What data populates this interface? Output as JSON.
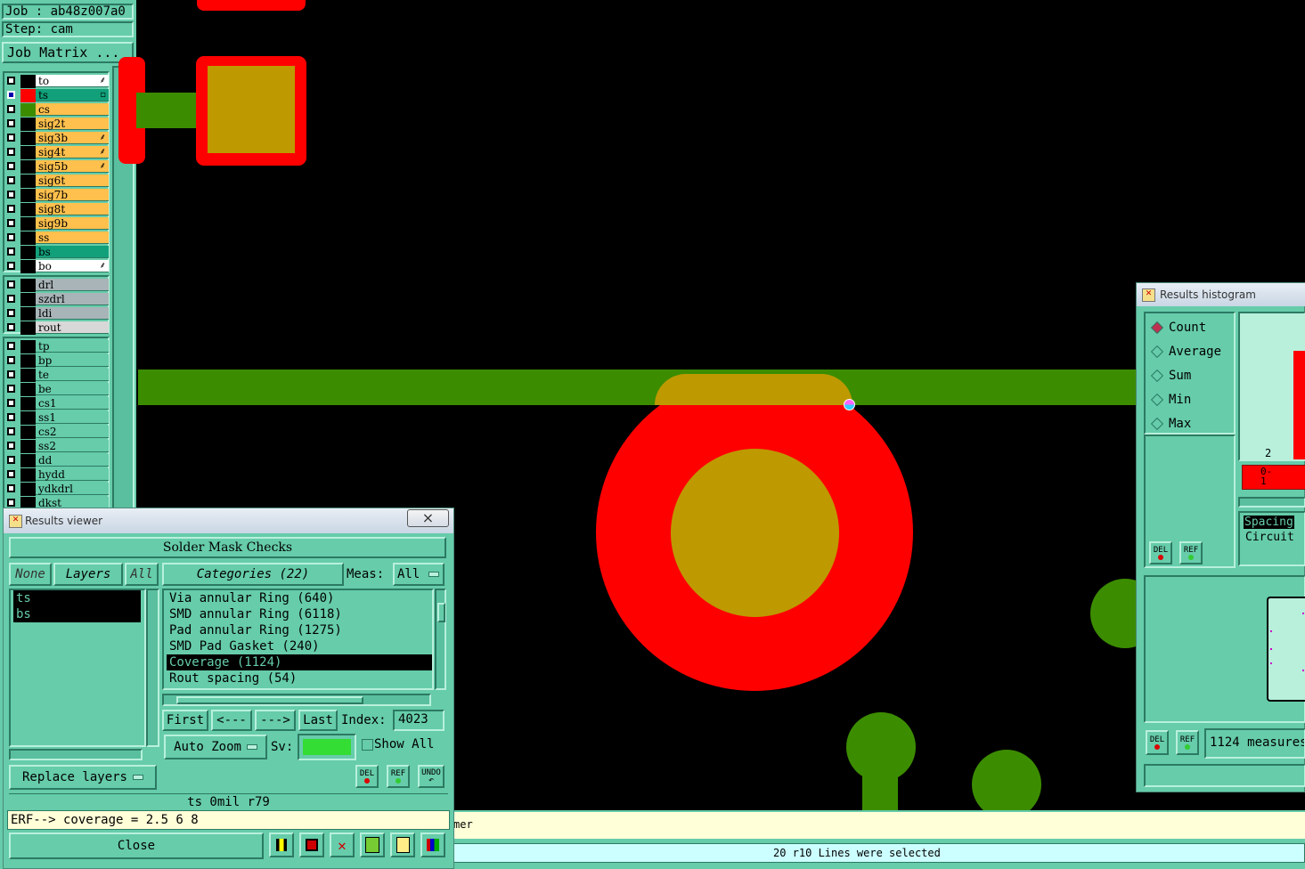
{
  "job": {
    "job_label": "Job : ab48z007a0",
    "step_label": "Step: cam",
    "matrix_button": "Job Matrix ..."
  },
  "layers": [
    {
      "name": "to",
      "color": "#ffffff",
      "swatch": "#000000",
      "mark": "⸙"
    },
    {
      "name": "ts",
      "color": "#11a07a",
      "swatch": "#ff0000",
      "mark": "▫",
      "active": true
    },
    {
      "name": "cs",
      "color": "#ffc04d",
      "swatch": "#3c8c00",
      "mark": ""
    },
    {
      "name": "sig2t",
      "color": "#ffc04d",
      "swatch": "#000000",
      "mark": ""
    },
    {
      "name": "sig3b",
      "color": "#ffc04d",
      "swatch": "#000000",
      "mark": "⸙"
    },
    {
      "name": "sig4t",
      "color": "#ffc04d",
      "swatch": "#000000",
      "mark": "⸙"
    },
    {
      "name": "sig5b",
      "color": "#ffc04d",
      "swatch": "#000000",
      "mark": "⸙"
    },
    {
      "name": "sig6t",
      "color": "#ffc04d",
      "swatch": "#000000",
      "mark": ""
    },
    {
      "name": "sig7b",
      "color": "#ffc04d",
      "swatch": "#000000",
      "mark": ""
    },
    {
      "name": "sig8t",
      "color": "#ffc04d",
      "swatch": "#000000",
      "mark": ""
    },
    {
      "name": "sig9b",
      "color": "#ffc04d",
      "swatch": "#000000",
      "mark": ""
    },
    {
      "name": "ss",
      "color": "#ffc04d",
      "swatch": "#000000",
      "mark": ""
    },
    {
      "name": "bs",
      "color": "#11a07a",
      "swatch": "#000000",
      "mark": ""
    },
    {
      "name": "bo",
      "color": "#ffffff",
      "swatch": "#000000",
      "mark": "⸙"
    }
  ],
  "drill_layers": [
    {
      "name": "drl",
      "color": "#a8b4b8",
      "swatch": "#000000"
    },
    {
      "name": "szdrl",
      "color": "#a8b4b8",
      "swatch": "#000000"
    },
    {
      "name": "ldi",
      "color": "#a8b4b8",
      "swatch": "#000000"
    },
    {
      "name": "rout",
      "color": "#d8d8d8",
      "swatch": "#000000"
    }
  ],
  "misc_layers": [
    {
      "name": "tp"
    },
    {
      "name": "bp"
    },
    {
      "name": "te"
    },
    {
      "name": "be"
    },
    {
      "name": "cs1"
    },
    {
      "name": "ss1"
    },
    {
      "name": "cs2"
    },
    {
      "name": "ss2"
    },
    {
      "name": "dd"
    },
    {
      "name": "hydd"
    },
    {
      "name": "ydkdrl"
    },
    {
      "name": "dkst"
    }
  ],
  "colors": {
    "panel": "#66ccaa",
    "board": "#000000",
    "pad_red": "#ff0000",
    "copper_green": "#3c8c00",
    "overlap": "#bf9900",
    "selected_green": "#33dd33"
  },
  "results_viewer": {
    "title": "Results viewer",
    "header": "Solder Mask Checks",
    "none_btn": "None",
    "layers_btn": "Layers",
    "all_btn": "All",
    "categories_btn": "Categories (22)",
    "meas_label": "Meas:",
    "meas_value": "All",
    "layer_list": [
      "ts",
      "bs"
    ],
    "categories": [
      "Via annular Ring (640)",
      "SMD annular Ring (6118)",
      "Pad annular Ring (1275)",
      "SMD Pad Gasket (240)",
      "Coverage (1124)",
      "Rout spacing (54)"
    ],
    "selected_category": 4,
    "first_btn": "First",
    "prev_btn": "<---",
    "next_btn": "--->",
    "last_btn": "Last",
    "index_label": "Index:",
    "index_value": "4023",
    "autozoom": "Auto Zoom",
    "sv_label": "Sv:",
    "show_all": "Show All",
    "replace_layers": "Replace layers",
    "del": "DEL",
    "ref": "REF",
    "undo": "UNDO",
    "info_line": "ts 0mil  r79",
    "erf_line": "ERF--> coverage = 2.5 6 8",
    "close": "Close"
  },
  "histogram": {
    "title": "Results histogram",
    "options": [
      "Count",
      "Average",
      "Sum",
      "Min",
      "Max"
    ],
    "selected": 0,
    "axis_top": "2",
    "bin_label": "0-\n1",
    "chips": [
      "Spacing",
      "Circuit"
    ],
    "del": "DEL",
    "ref": "REF",
    "measures_text": "1124 measures"
  },
  "status": {
    "left_fragment": "mer",
    "message": "20 r10 Lines were selected"
  },
  "close_x": "×"
}
